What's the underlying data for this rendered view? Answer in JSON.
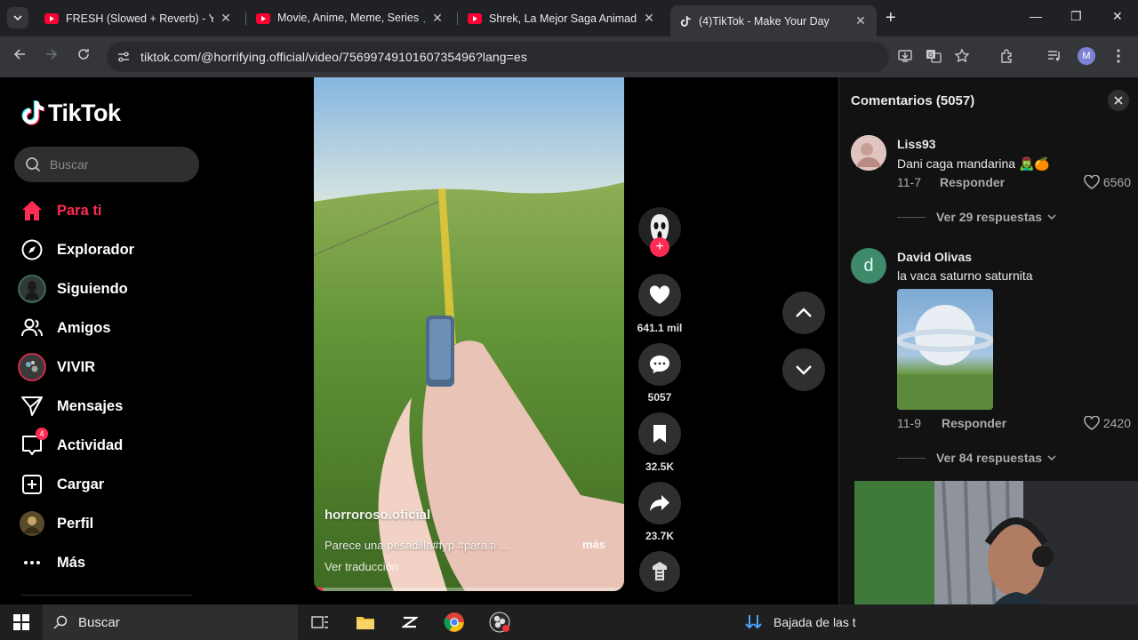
{
  "browser": {
    "tabs": [
      {
        "title": "FRESH (Slowed + Reverb) - You",
        "icon": "youtube-icon"
      },
      {
        "title": "Movie, Anime, Meme, Series 🎵",
        "icon": "youtube-icon"
      },
      {
        "title": "Shrek, La Mejor Saga Animada",
        "icon": "youtube-icon"
      },
      {
        "title": "(4)TikTok - Make Your Day",
        "icon": "tiktok-icon"
      }
    ],
    "url": "tiktok.com/@horrifying.official/video/7569974910160735496?lang=es",
    "profile_initial": "M"
  },
  "sidebar": {
    "logo_text": "TikTok",
    "search_placeholder": "Buscar",
    "items": [
      {
        "label": "Para ti",
        "icon": "home-icon",
        "active": true
      },
      {
        "label": "Explorador",
        "icon": "compass-icon"
      },
      {
        "label": "Siguiendo",
        "icon": "following-avatar-icon"
      },
      {
        "label": "Amigos",
        "icon": "friends-icon"
      },
      {
        "label": "VIVIR",
        "icon": "live-icon"
      },
      {
        "label": "Mensajes",
        "icon": "send-icon"
      },
      {
        "label": "Actividad",
        "icon": "inbox-icon",
        "badge": "4"
      },
      {
        "label": "Cargar",
        "icon": "upload-icon"
      },
      {
        "label": "Perfil",
        "icon": "profile-avatar-icon"
      },
      {
        "label": "Más",
        "icon": "more-icon"
      }
    ]
  },
  "video": {
    "author": "horroroso.oficial",
    "description": "Parece una pesadilla#fyp #para ti ...",
    "more": "más",
    "translate": "Ver traducción",
    "progress": 0.03
  },
  "actions": {
    "likes": "641.1 mil",
    "comments": "5057",
    "saves": "32.5K",
    "shares": "23.7K"
  },
  "comments_panel": {
    "title": "Comentarios (5057)",
    "comments": [
      {
        "user": "Liss93",
        "text": "Dani caga mandarina 🧟‍♂️🍊",
        "date": "11-7",
        "reply": "Responder",
        "likes": "6560",
        "more": "Ver 29 respuestas"
      },
      {
        "user": "David Olivas",
        "avatar_letter": "d",
        "text": "la vaca saturno saturnita",
        "date": "11-9",
        "reply": "Responder",
        "likes": "2420",
        "more": "Ver 84 respuestas"
      }
    ]
  },
  "taskbar": {
    "search_text": "Buscar",
    "news_text": "Bajada de las t"
  },
  "colors": {
    "accent": "#fe2c55",
    "background": "#000000",
    "panel": "#121212"
  }
}
